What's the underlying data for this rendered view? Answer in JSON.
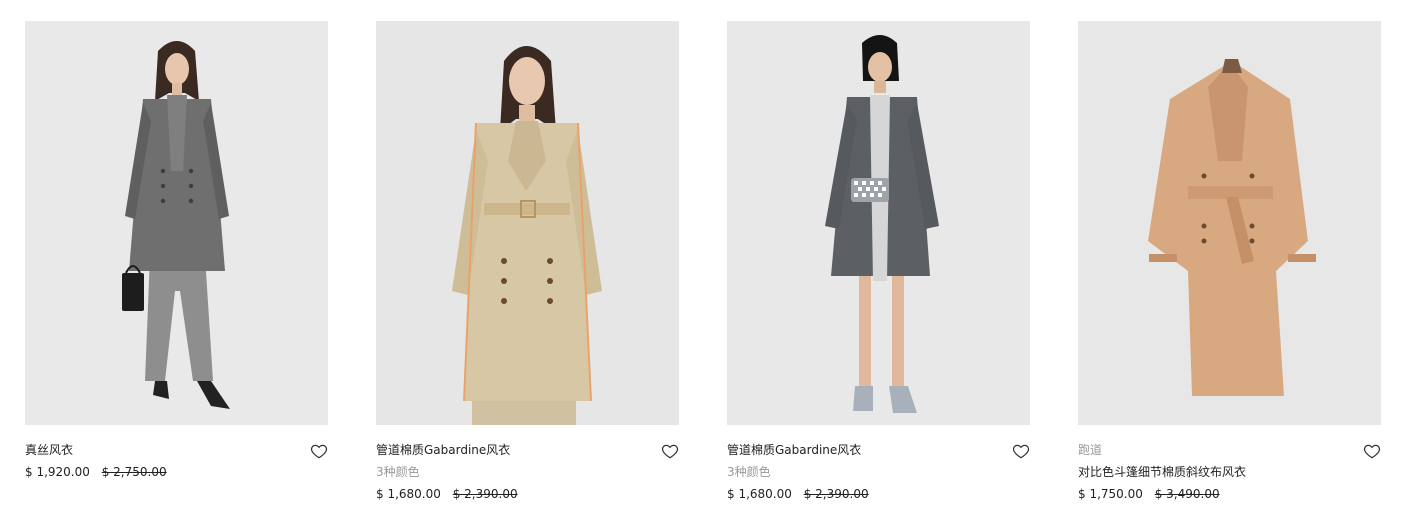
{
  "products": [
    {
      "name": "真丝风衣",
      "price": "$ 1,920.00",
      "original_price": "$ 2,750.00",
      "wishlist_icon": "heart-outline-icon"
    },
    {
      "name": "管道棉质Gabardine风衣",
      "colors": "3种颜色",
      "price": "$ 1,680.00",
      "original_price": "$ 2,390.00",
      "wishlist_icon": "heart-outline-icon"
    },
    {
      "name": "管道棉质Gabardine风衣",
      "colors": "3种颜色",
      "price": "$ 1,680.00",
      "original_price": "$ 2,390.00",
      "wishlist_icon": "heart-outline-icon"
    },
    {
      "tag": "跑道",
      "name": "对比色斗篷细节棉质斜纹布风衣",
      "price": "$ 1,750.00",
      "original_price": "$ 3,490.00",
      "wishlist_icon": "heart-outline-icon"
    }
  ],
  "colors": {
    "photo_background": "#e8e8e8",
    "text": "#222222",
    "muted_text": "#999999",
    "coat_grey": "#6f6f6f",
    "coat_honey": "#d8c7a4",
    "coat_charcoal": "#5c5f64",
    "coat_camel": "#d8a981"
  }
}
